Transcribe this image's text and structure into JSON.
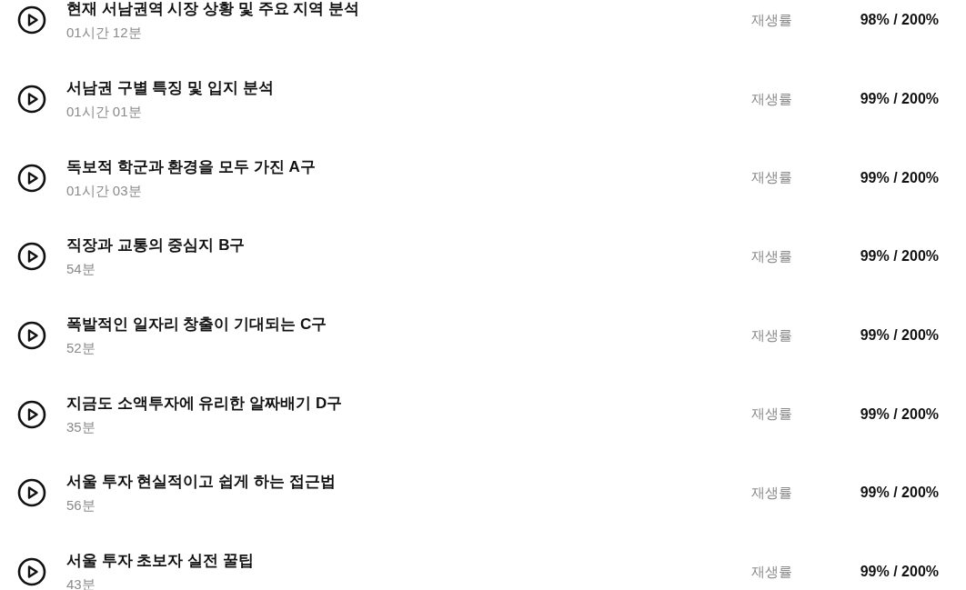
{
  "lectures": [
    {
      "title": "현재 서남권역 시장 상황 및 주요 지역 분석",
      "duration": "01시간 12분",
      "rate_label": "재생률",
      "rate": "98% / 200%"
    },
    {
      "title": "서남권 구별 특징 및 입지 분석",
      "duration": "01시간 01분",
      "rate_label": "재생률",
      "rate": "99% / 200%"
    },
    {
      "title": "독보적 학군과 환경을 모두 가진 A구",
      "duration": "01시간 03분",
      "rate_label": "재생률",
      "rate": "99% / 200%"
    },
    {
      "title": "직장과 교통의 중심지 B구",
      "duration": "54분",
      "rate_label": "재생률",
      "rate": "99% / 200%"
    },
    {
      "title": "폭발적인 일자리 창출이 기대되는 C구",
      "duration": "52분",
      "rate_label": "재생률",
      "rate": "99% / 200%"
    },
    {
      "title": "지금도 소액투자에 유리한 알짜배기 D구",
      "duration": "35분",
      "rate_label": "재생률",
      "rate": "99% / 200%"
    },
    {
      "title": "서울 투자 현실적이고 쉽게 하는 접근법",
      "duration": "56분",
      "rate_label": "재생률",
      "rate": "99% / 200%"
    },
    {
      "title": "서울 투자 초보자 실전 꿀팁",
      "duration": "43분",
      "rate_label": "재생률",
      "rate": "99% / 200%"
    }
  ]
}
